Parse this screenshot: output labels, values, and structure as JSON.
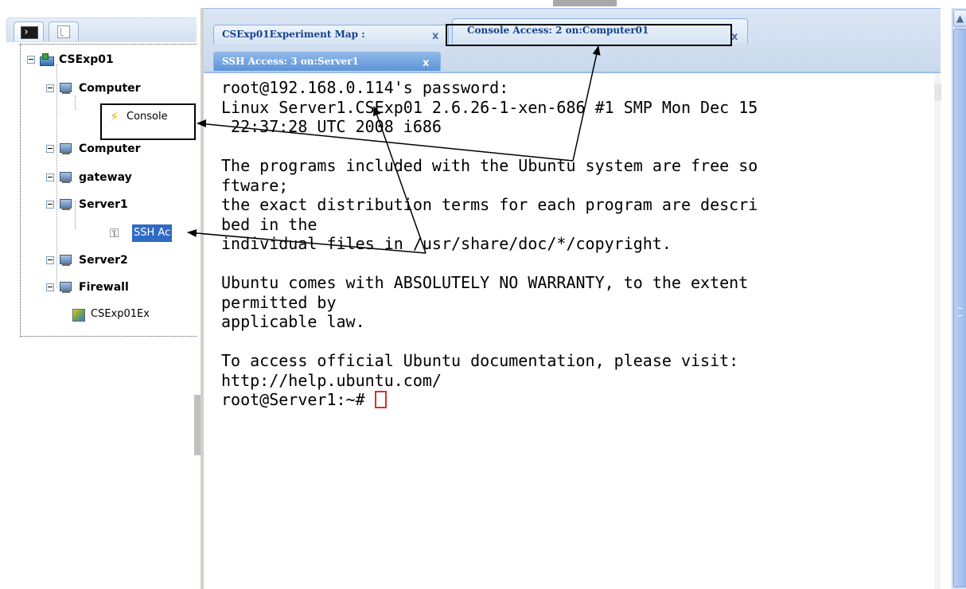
{
  "tree": {
    "nodes": [
      {
        "label": "CSExp01"
      },
      {
        "label": "Computer"
      },
      {
        "label": "Console"
      },
      {
        "label": "Computer"
      },
      {
        "label": "gateway"
      },
      {
        "label": "Server1"
      },
      {
        "label": "SSH Ac"
      },
      {
        "label": "Server2"
      },
      {
        "label": "Firewall"
      },
      {
        "label": "CSExp01Ex"
      }
    ]
  },
  "tabs": [
    {
      "label": "CSExp01Experiment Map :",
      "close": "x"
    },
    {
      "label": "Console Access: 2 on:Computer01",
      "close": "x"
    },
    {
      "label": "SSH Access: 3 on:Server1",
      "close": "x"
    }
  ],
  "terminal": {
    "lines": [
      "root@192.168.0.114's password:",
      "Linux Server1.CSExp01 2.6.26-1-xen-686 #1 SMP Mon Dec 15",
      " 22:37:28 UTC 2008 i686",
      "",
      "The programs included with the Ubuntu system are free so",
      "ftware;",
      "the exact distribution terms for each program are descri",
      "bed in the",
      "individual files in /usr/share/doc/*/copyright.",
      "",
      "Ubuntu comes with ABSOLUTELY NO WARRANTY, to the extent",
      "permitted by",
      "applicable law.",
      "",
      "To access official Ubuntu documentation, please visit:",
      "http://help.ubuntu.com/"
    ],
    "prompt": "root@Server1:~# "
  },
  "scroll": {
    "up_arrow": "▲"
  },
  "icons": {
    "terminal_tab": "terminal-icon",
    "tree_tab": "tree-view-icon",
    "experiment": "network-icon",
    "computer": "computer-icon",
    "console": "lightning-icon",
    "ssh": "ssh-key-icon",
    "map": "map-icon"
  },
  "colors": {
    "selection": "#316ac5",
    "tab_text": "#15428b",
    "cursor": "#d9302a",
    "annotation": "#000000"
  }
}
